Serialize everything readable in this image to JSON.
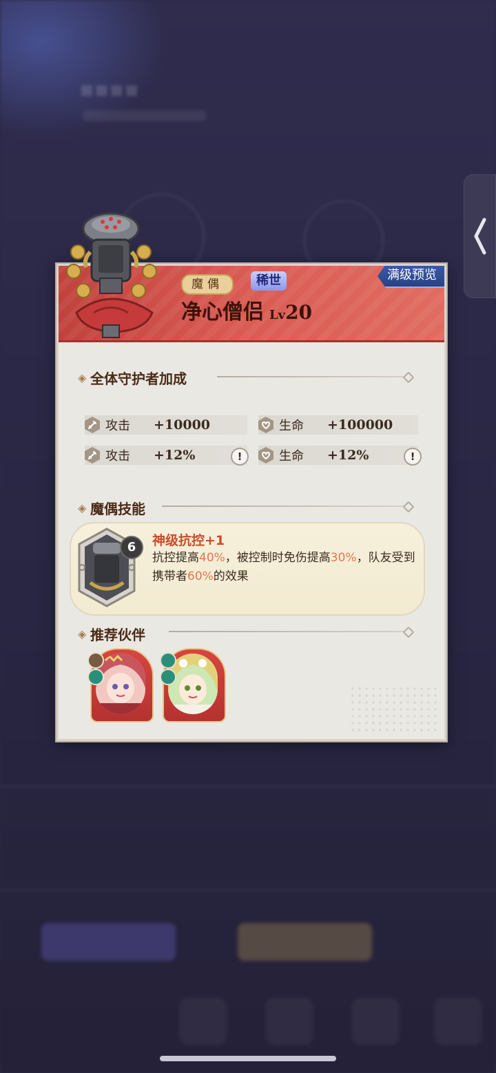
{
  "card": {
    "type_badge": "魔偶",
    "rarity_badge": "稀世",
    "preview_label": "满级预览",
    "unit_name": "净心僧侣",
    "level_prefix": "Lv",
    "level_value": "20"
  },
  "guardian_bonus": {
    "title": "全体守护者加成",
    "stats": [
      {
        "icon": "sword-icon",
        "label": "攻击",
        "value": "+10000"
      },
      {
        "icon": "heart-icon",
        "label": "生命",
        "value": "+100000"
      },
      {
        "icon": "sword-icon",
        "label": "攻击",
        "value": "+12%"
      },
      {
        "icon": "heart-icon",
        "label": "生命",
        "value": "+12%"
      }
    ],
    "info_symbol": "!"
  },
  "skill": {
    "section_title": "魔偶技能",
    "level": "6",
    "name": "神级抗控+1",
    "desc_parts": [
      "抗控提高",
      "40%",
      "，被控制时免伤提高",
      "30%",
      "，队友受到携带者",
      "60%",
      "的效果"
    ]
  },
  "partners": {
    "section_title": "推荐伙伴",
    "items": [
      {
        "name": "partner-pink-hair",
        "hair": "#c8565f",
        "badge_top": "#7a5a42",
        "badge_bottom": "#2a8f7a"
      },
      {
        "name": "partner-blonde-hair",
        "hair": "#e3d27a",
        "badge_top": "#2a8f7a",
        "badge_bottom": "#2a8f7a"
      }
    ]
  },
  "colors": {
    "header_red": "#c0423d",
    "highlight": "#e0764f",
    "preview_blue": "#2a4284"
  }
}
